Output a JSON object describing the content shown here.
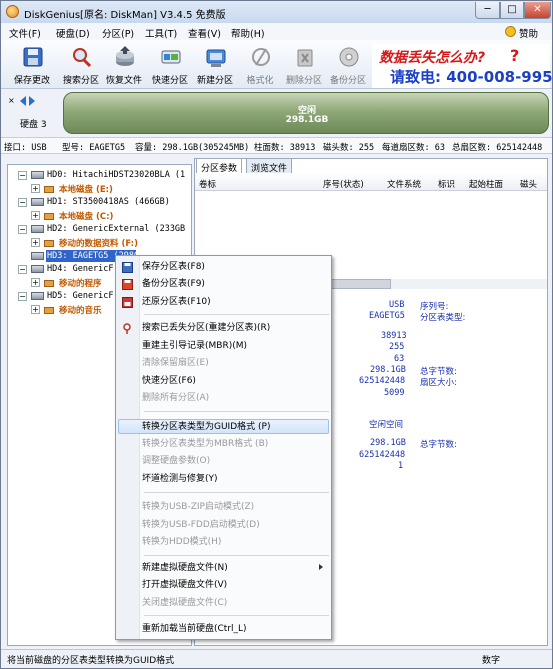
{
  "window": {
    "title": "DiskGenius[原名: DiskMan] V3.4.5 免费版",
    "min_label": "─",
    "max_label": "□",
    "close_label": "✕"
  },
  "menubar": {
    "items": [
      "文件(F)",
      "硬盘(D)",
      "分区(P)",
      "工具(T)",
      "查看(V)",
      "帮助(H)"
    ],
    "help_label": "赞助"
  },
  "toolbar": {
    "buttons": [
      {
        "label": "保存更改",
        "icon": "save-icon",
        "enabled": true
      },
      {
        "label": "搜索分区",
        "icon": "search-icon",
        "enabled": true
      },
      {
        "label": "恢复文件",
        "icon": "recover-file-icon",
        "enabled": true
      },
      {
        "label": "快速分区",
        "icon": "quick-partition-icon",
        "enabled": true
      },
      {
        "label": "新建分区",
        "icon": "new-partition-icon",
        "enabled": true
      },
      {
        "label": "格式化",
        "icon": "format-icon",
        "enabled": false
      },
      {
        "label": "删除分区",
        "icon": "delete-partition-icon",
        "enabled": false
      },
      {
        "label": "备份分区",
        "icon": "backup-partition-icon",
        "enabled": false
      }
    ]
  },
  "ad": {
    "line1": "数据丢失怎么办?",
    "line2": "请致电: 400-008-9958",
    "mark": "?"
  },
  "disk_view": {
    "label": "硬盘 3",
    "bar_line1": "空闲",
    "bar_line2": "298.1GB"
  },
  "info_bar": {
    "interface": "接口: USB",
    "model": "型号: EAGETG5",
    "capacity": "容量: 298.1GB(305245MB)",
    "cylinders": "柱面数: 38913",
    "heads": "磁头数: 255",
    "sectors_per_track": "每道扇区数: 63",
    "total_sectors": "总扇区数: 625142448"
  },
  "tree": {
    "nodes": [
      {
        "text": "HD0: HitachiHDST23020BLA (1",
        "type": "disk"
      },
      {
        "text": "本地磁盘 (E:)",
        "type": "partition"
      },
      {
        "text": "HD1: ST3500418AS (466GB)",
        "type": "disk"
      },
      {
        "text": "本地磁盘 (C:)",
        "type": "partition"
      },
      {
        "text": "HD2: GenericExternal (233GB",
        "type": "disk"
      },
      {
        "text": "移动的数据资料 (F:)",
        "type": "partition"
      },
      {
        "text": "HD3: EAGETG5 (298GB)",
        "type": "disk",
        "selected": true
      },
      {
        "text": "HD4: GenericF",
        "type": "disk"
      },
      {
        "text": "移动的程序",
        "type": "partition"
      },
      {
        "text": "HD5: GenericF",
        "type": "disk"
      },
      {
        "text": "移动的音乐",
        "type": "partition"
      }
    ]
  },
  "tabs": [
    "分区参数",
    "浏览文件"
  ],
  "columns": [
    "卷标",
    "序号(状态)",
    "文件系统",
    "标识",
    "起始柱面",
    "磁头"
  ],
  "details": {
    "iface_val": "USB",
    "model_val": "EAGETG5",
    "serial_label": "序列号:",
    "ptype_label": "分区表类型:",
    "cyl_val": "38913",
    "heads_val": "255",
    "spt_val": "63",
    "size_val": "298.1GB",
    "total_bytes_label": "总字节数:",
    "total_sectors_val": "625142448",
    "sector_size_label": "扇区大小:",
    "extra_val": "5099",
    "free_label": "空闲空间",
    "free_size_val": "298.1GB",
    "free_bytes_label": "总字节数:",
    "free_sectors_val": "625142448",
    "one_val": "1"
  },
  "context_menu": {
    "items": [
      {
        "label": "保存分区表(F8)",
        "enabled": true,
        "icon": "save-icon"
      },
      {
        "label": "备份分区表(F9)",
        "enabled": true,
        "icon": "backup-icon"
      },
      {
        "label": "还原分区表(F10)",
        "enabled": true,
        "icon": "restore-icon"
      },
      {
        "label": "搜索已丢失分区(重建分区表)(R)",
        "enabled": true,
        "icon": "search-icon"
      },
      {
        "label": "重建主引导记录(MBR)(M)",
        "enabled": true
      },
      {
        "label": "清除保留扇区(E)",
        "enabled": false
      },
      {
        "label": "快速分区(F6)",
        "enabled": true
      },
      {
        "label": "删除所有分区(A)",
        "enabled": false
      },
      {
        "label": "转换分区表类型为GUID格式 (P)",
        "enabled": true,
        "highlighted": true
      },
      {
        "label": "转换分区表类型为MBR格式 (B)",
        "enabled": false
      },
      {
        "label": "调整硬盘参数(O)",
        "enabled": false
      },
      {
        "label": "坏道检测与修复(Y)",
        "enabled": true
      },
      {
        "label": "转换为USB-ZIP启动模式(Z)",
        "enabled": false
      },
      {
        "label": "转换为USB-FDD启动模式(D)",
        "enabled": false
      },
      {
        "label": "转换为HDD模式(H)",
        "enabled": false
      },
      {
        "label": "新建虚拟硬盘文件(N)",
        "enabled": true,
        "submenu": true
      },
      {
        "label": "打开虚拟硬盘文件(V)",
        "enabled": true
      },
      {
        "label": "关闭虚拟硬盘文件(C)",
        "enabled": false
      },
      {
        "label": "重新加载当前硬盘(Ctrl_L)",
        "enabled": true
      }
    ]
  },
  "status": {
    "text": "将当前磁盘的分区表类型转换为GUID格式",
    "mode": "数字"
  }
}
